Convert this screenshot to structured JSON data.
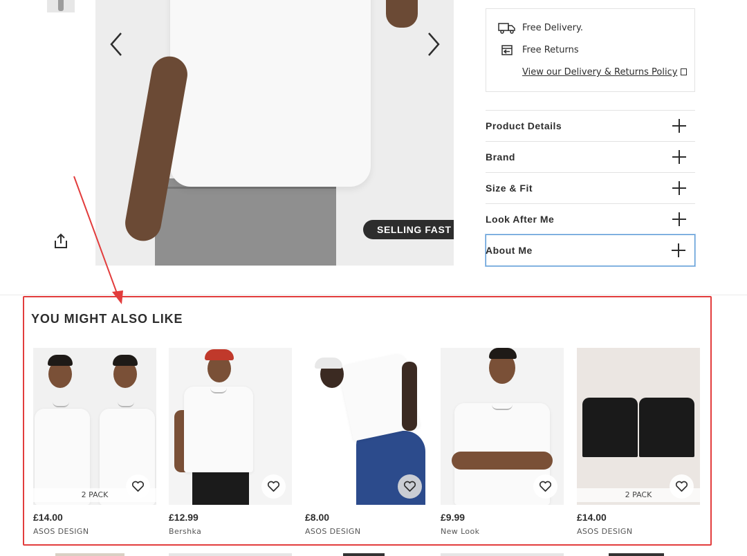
{
  "delivery": {
    "free_delivery": "Free Delivery.",
    "free_returns": "Free Returns",
    "policy_link": "View our Delivery & Returns Policy"
  },
  "badges": {
    "selling_fast": "SELLING FAST"
  },
  "accordion": [
    {
      "label": "Product Details"
    },
    {
      "label": "Brand"
    },
    {
      "label": "Size & Fit"
    },
    {
      "label": "Look After Me"
    },
    {
      "label": "About Me"
    }
  ],
  "recommendations": {
    "title": "YOU MIGHT ALSO LIKE",
    "items": [
      {
        "price": "£14.00",
        "brand": "ASOS DESIGN",
        "badge": "2 PACK"
      },
      {
        "price": "£12.99",
        "brand": "Bershka"
      },
      {
        "price": "£8.00",
        "brand": "ASOS DESIGN"
      },
      {
        "price": "£9.99",
        "brand": "New Look"
      },
      {
        "price": "£14.00",
        "brand": "ASOS DESIGN",
        "badge": "2 PACK"
      }
    ]
  },
  "colors": {
    "text": "#2d2d2d",
    "annotation_red": "#e23c3c",
    "focus_blue": "#5b9bd5"
  },
  "icons": [
    "chevron-left-icon",
    "chevron-right-icon",
    "share-icon",
    "truck-icon",
    "returns-icon",
    "external-link-icon",
    "plus-icon",
    "heart-icon"
  ]
}
